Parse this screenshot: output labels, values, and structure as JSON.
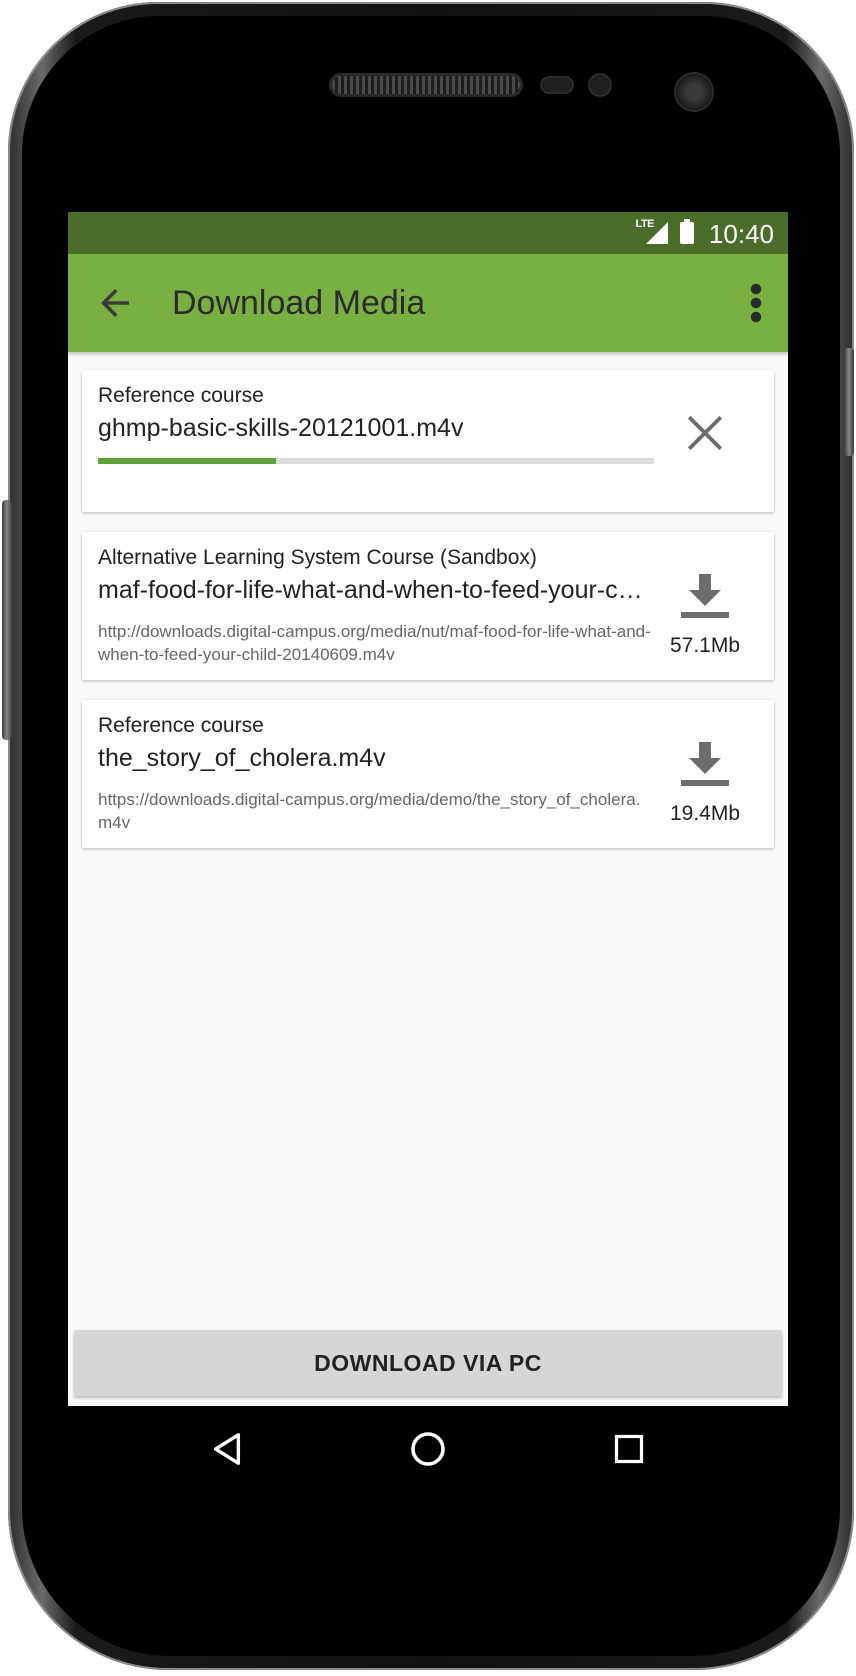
{
  "statusbar": {
    "network": "LTE",
    "time": "10:40"
  },
  "appbar": {
    "title": "Download Media"
  },
  "downloads": [
    {
      "course": "Reference course",
      "filename": "ghmp-basic-skills-20121001.m4v",
      "progress": 0.32,
      "state": "downloading"
    },
    {
      "course": "Alternative Learning System Course (Sandbox)",
      "filename": "maf-food-for-life-what-and-when-to-feed-your-child-20140609.m4v",
      "url": "http://downloads.digital-campus.org/media/nut/maf-food-for-life-what-and-when-to-feed-your-child-20140609.m4v",
      "size": "57.1Mb"
    },
    {
      "course": "Reference course",
      "filename": "the_story_of_cholera.m4v",
      "url": "https://downloads.digital-campus.org/media/demo/the_story_of_cholera.m4v",
      "size": "19.4Mb"
    }
  ],
  "footer": {
    "button_label": "DOWNLOAD VIA PC"
  },
  "colors": {
    "appbar": "#78b042",
    "statusbar": "#4a6d2a",
    "progress": "#5ea23a"
  }
}
